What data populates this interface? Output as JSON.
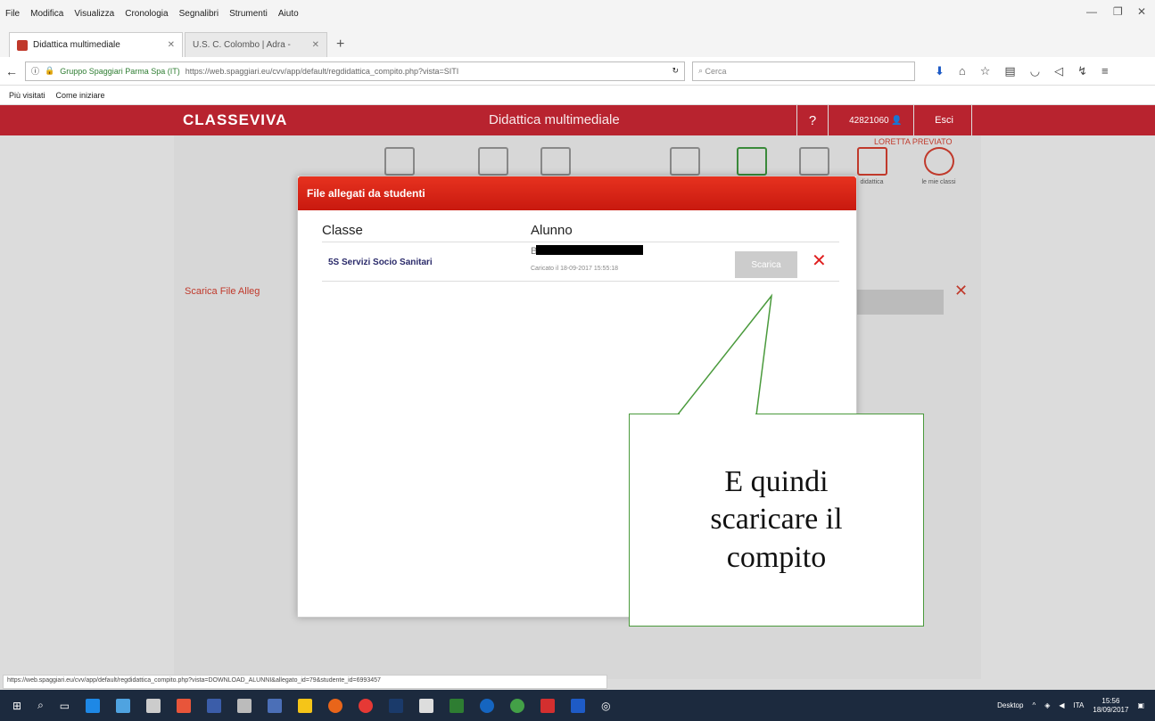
{
  "browser": {
    "menu": [
      "File",
      "Modifica",
      "Visualizza",
      "Cronologia",
      "Segnalibri",
      "Strumenti",
      "Aiuto"
    ],
    "tabs": [
      {
        "title": "Didattica multimediale",
        "active": true
      },
      {
        "title": "U.S. C. Colombo | Adra -",
        "active": false
      }
    ],
    "identity": "Gruppo Spaggiari Parma Spa (IT)",
    "url": "https://web.spaggiari.eu/cvv/app/default/regdidattica_compito.php?vista=SITI",
    "search_placeholder": "Cerca",
    "bookmarks": [
      "Più visitati",
      "Come iniziare"
    ],
    "status_url": "https://web.spaggiari.eu/cvv/app/default/regdidattica_compito.php?vista=DOWNLOAD_ALUNNI&allegato_id=79&studente_id=6993457"
  },
  "app": {
    "logo": "CLASSEVIVA",
    "title": "Didattica multimediale",
    "help": "?",
    "user_code": "42821060",
    "exit": "Esci",
    "teacher": "LORETTA PREVIATO",
    "tools": [
      "didattica",
      "le mie classi"
    ],
    "scarica_label": "Scarica File  Alleg"
  },
  "modal": {
    "title": "File allegati da studenti",
    "col_class": "Classe",
    "col_student": "Alunno",
    "row": {
      "class": "5S Servizi Socio Sanitari",
      "student": "B",
      "date": "Caricato il 18-09-2017 15:55:18",
      "download": "Scarica"
    },
    "delete": "✕"
  },
  "callout": {
    "line1": "E quindi",
    "line2": "scaricare il",
    "line3": "compito"
  },
  "taskbar": {
    "desktop": "Desktop",
    "lang": "ITA",
    "time": "15:56",
    "date": "18/09/2017"
  },
  "colors": {
    "header": "#b8232f",
    "modal_header": "#e7321f",
    "callout_border": "#4a9a3c",
    "taskbar": "#1c2a3e"
  }
}
